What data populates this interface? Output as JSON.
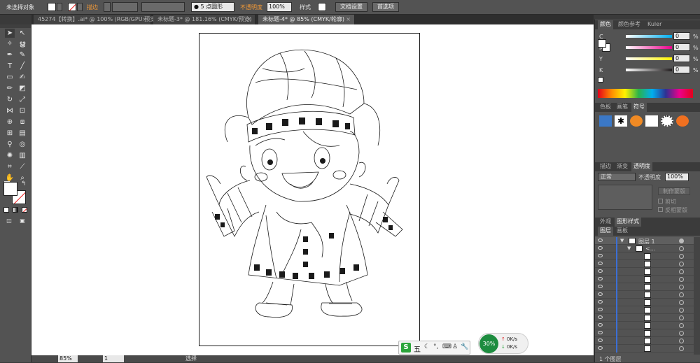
{
  "control_bar": {
    "selection_label": "未选择对象",
    "stroke_label": "描边",
    "brush_value": "5 点圆形",
    "opacity_label": "不透明度",
    "opacity_value": "100%",
    "style_label": "样式",
    "doc_setup_button": "文档设置",
    "preferences_button": "首选项"
  },
  "tabs": [
    {
      "label": "45274【转换】.ai* @ 100% (RGB/GPU 预览)",
      "close": "×"
    },
    {
      "label": "未标题-3* @ 181.16% (CMYK/预览)",
      "close": "×"
    },
    {
      "label": "未标题-4* @ 85% (CMYK/轮廓)",
      "close": "×"
    }
  ],
  "status_bar": {
    "zoom": "85%",
    "page": "1",
    "tool_name": "选择"
  },
  "color_panel": {
    "tabs": [
      "颜色",
      "颜色参考",
      "Kuler"
    ],
    "channels": [
      {
        "label": "C",
        "value": "0",
        "color": "#00aeef"
      },
      {
        "label": "M",
        "value": "0",
        "color": "#ec008c"
      },
      {
        "label": "Y",
        "value": "0",
        "color": "#fff200"
      },
      {
        "label": "K",
        "value": "0",
        "color": "#231f20"
      }
    ],
    "percent_sign": "%"
  },
  "symbols_panel": {
    "tabs": [
      "色板",
      "画笔",
      "符号"
    ]
  },
  "transparency_panel": {
    "tabs": [
      "描边",
      "渐变",
      "透明度"
    ],
    "blend_mode": "正常",
    "opacity_label": "不透明度",
    "opacity_value": "100%",
    "make_mask_button": "制作蒙版",
    "clip_label": "剪切",
    "invert_mask_label": "反相蒙版"
  },
  "appearance_panel": {
    "tabs": [
      "外观",
      "图形样式"
    ]
  },
  "layers_panel": {
    "tabs": [
      "图层",
      "画板"
    ],
    "layer_name": "图层 1",
    "group_name": "<...",
    "layer_count": "1 个图层"
  },
  "taskbar": {
    "ime_label": "五",
    "ime_brand": "S",
    "net_percent": "30%",
    "upload": "0K/s",
    "download": "0K/s"
  }
}
